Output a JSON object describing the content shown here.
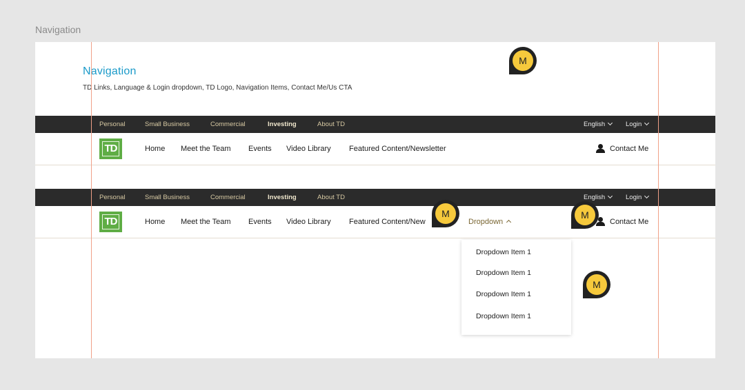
{
  "frame_label": "Navigation",
  "page": {
    "title": "Navigation",
    "description": "TD Links, Language & Login dropdown, TD Logo, Navigation Items, Contact Me/Us CTA"
  },
  "topbar": {
    "links": [
      "Personal",
      "Small Business",
      "Commercial",
      "Investing",
      "About TD"
    ],
    "active": "Investing",
    "language": "English",
    "login": "Login"
  },
  "logo_text": "TD",
  "mainnav": {
    "items": [
      "Home",
      "Meet the Team",
      "Events",
      "Video Library",
      "Featured Content/Newsletter"
    ],
    "items_truncated": [
      "Home",
      "Meet the Team",
      "Events",
      "Video Library",
      "Featured Content/New"
    ],
    "dropdown_label": "Dropdown",
    "contact": "Contact Me"
  },
  "dropdown_items": [
    "Dropdown Item 1",
    "Dropdown Item 1",
    "Dropdown Item 1",
    "Dropdown Item 1"
  ],
  "marker_label": "M",
  "colors": {
    "accent_blue": "#1a9ac9",
    "td_green": "#5fad45",
    "topbar_bg": "#2b2b2b",
    "marker_yellow": "#f6c93c",
    "guide": "#f0a088"
  }
}
